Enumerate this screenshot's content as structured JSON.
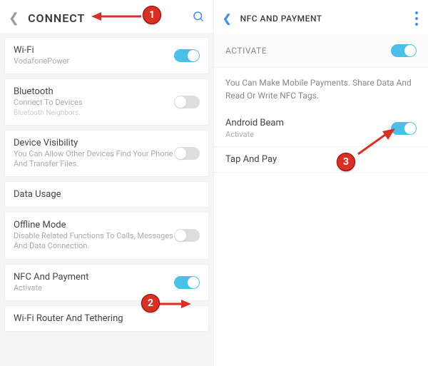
{
  "left": {
    "header": {
      "title": "CONNECT"
    },
    "items": [
      {
        "title": "Wi-Fi",
        "sub": "VodafonePower",
        "note": "",
        "toggle": "on"
      },
      {
        "title": "Bluetooth",
        "sub": "Connect To Devices",
        "note": "Bluetooth Neighbors.",
        "toggle": "off"
      },
      {
        "title": "Device Visibility",
        "sub": "You Can Allow Other Devices Find Your Phone And Transfer Files.",
        "note": "",
        "toggle": "off"
      },
      {
        "title": "Data Usage",
        "sub": "",
        "note": "",
        "toggle": ""
      },
      {
        "title": "Offline Mode",
        "sub": "Disable Related Functions To Calls, Messages And Data Connection.",
        "note": "",
        "toggle": "off"
      },
      {
        "title": "NFC And Payment",
        "sub": "Activate",
        "note": "",
        "toggle": "on"
      },
      {
        "title": "Wi-Fi Router And Tethering",
        "sub": "",
        "note": "",
        "toggle": ""
      }
    ]
  },
  "right": {
    "header": {
      "title": "NFC AND PAYMENT"
    },
    "activate_label": "ACTIVATE",
    "info": "You Can Make Mobile Payments. Share Data And Read Or Write NFC Tags.",
    "beam": {
      "title": "Android Beam",
      "sub": "Activate"
    },
    "tap": {
      "title": "Tap And Pay"
    }
  },
  "annotations": {
    "b1": "1",
    "b2": "2",
    "b3": "3"
  }
}
